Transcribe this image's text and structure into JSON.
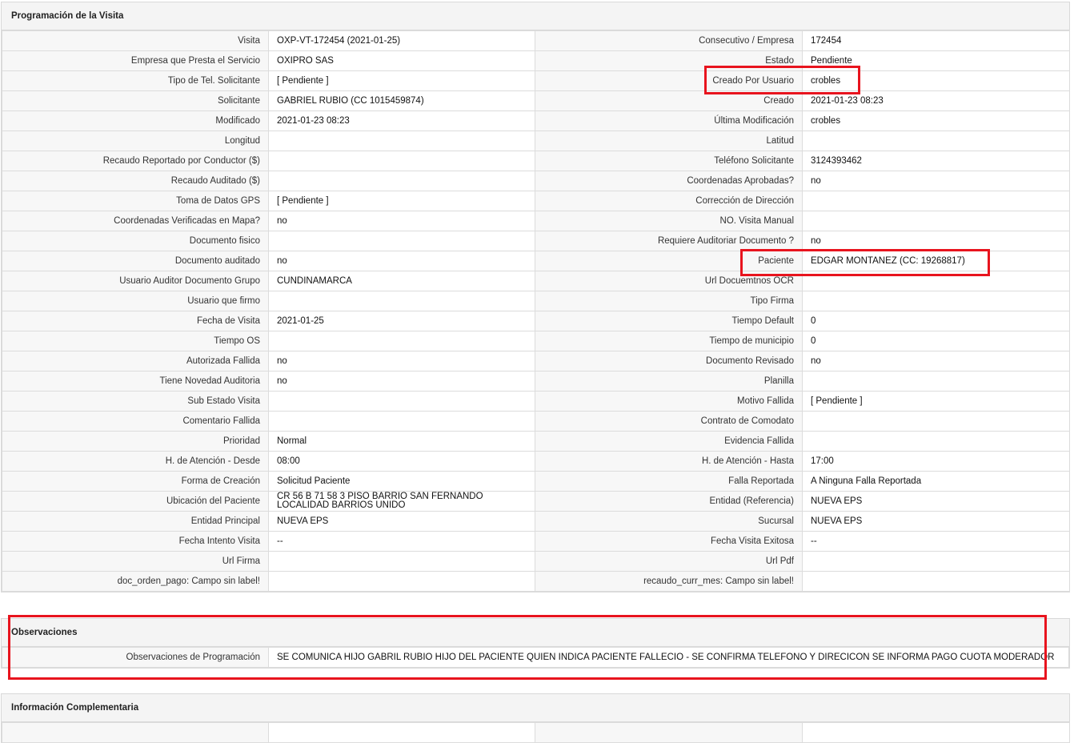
{
  "section1": {
    "title": "Programación de la Visita",
    "rows": [
      [
        "Visita",
        "OXP-VT-172454 (2021-01-25)",
        "Consecutivo / Empresa",
        "172454"
      ],
      [
        "Empresa que Presta el Servicio",
        "OXIPRO SAS",
        "Estado",
        "Pendiente"
      ],
      [
        "Tipo de Tel. Solicitante",
        "[ Pendiente ]",
        "Creado Por Usuario",
        "crobles"
      ],
      [
        "Solicitante",
        "GABRIEL RUBIO (CC 1015459874)",
        "Creado",
        "2021-01-23 08:23"
      ],
      [
        "Modificado",
        "2021-01-23 08:23",
        "Última Modificación",
        " crobles"
      ],
      [
        "Longitud",
        "",
        "Latitud",
        ""
      ],
      [
        "Recaudo Reportado por Conductor ($)",
        "",
        "Teléfono Solicitante",
        "3124393462"
      ],
      [
        "Recaudo Auditado ($)",
        "",
        "Coordenadas Aprobadas?",
        " no"
      ],
      [
        "Toma de Datos GPS",
        "[ Pendiente ]",
        "Corrección de Dirección",
        ""
      ],
      [
        "Coordenadas Verificadas en Mapa?",
        " no",
        "NO. Visita Manual",
        ""
      ],
      [
        "Documento fisico",
        "",
        "Requiere Auditoriar Documento ?",
        " no"
      ],
      [
        "Documento auditado",
        " no",
        "Paciente",
        "EDGAR MONTANEZ (CC: 19268817)"
      ],
      [
        "Usuario Auditor Documento Grupo",
        "CUNDINAMARCA",
        "Url Docuemtnos OCR",
        ""
      ],
      [
        "Usuario que firmo",
        "",
        "Tipo Firma",
        ""
      ],
      [
        "Fecha de Visita",
        " 2021-01-25",
        "Tiempo Default",
        "0"
      ],
      [
        "Tiempo OS",
        "",
        "Tiempo de municipio",
        "0"
      ],
      [
        "Autorizada Fallida",
        " no",
        "Documento Revisado",
        " no"
      ],
      [
        "Tiene Novedad Auditoria",
        " no",
        "Planilla",
        ""
      ],
      [
        "Sub Estado Visita",
        "",
        "Motivo Fallida",
        "[ Pendiente ]"
      ],
      [
        "Comentario Fallida",
        "",
        "Contrato de Comodato",
        ""
      ],
      [
        "Prioridad",
        "Normal",
        "Evidencia Fallida",
        ""
      ],
      [
        "H. de Atención - Desde",
        "08:00",
        "H. de Atención - Hasta",
        "17:00"
      ],
      [
        "Forma de Creación",
        "Solicitud Paciente",
        "Falla Reportada",
        "A Ninguna Falla Reportada"
      ],
      [
        "Ubicación del Paciente",
        "CR 56 B 71 58 3 PISO BARRIO SAN FERNANDO LOCALIDAD BARRIOS UNIDO",
        "Entidad (Referencia)",
        "NUEVA EPS"
      ],
      [
        "Entidad Principal",
        "NUEVA EPS",
        "Sucursal",
        "NUEVA EPS"
      ],
      [
        "Fecha Intento Visita",
        " --",
        "Fecha Visita Exitosa",
        " --"
      ],
      [
        "Url Firma",
        "",
        "Url Pdf",
        ""
      ],
      [
        "doc_orden_pago: Campo sin label!",
        "",
        "recaudo_curr_mes: Campo sin label!",
        ""
      ]
    ]
  },
  "section2": {
    "title": "Observaciones",
    "label": "Observaciones de Programación",
    "value": "SE COMUNICA HIJO GABRIL RUBIO HIJO DEL PACIENTE QUIEN INDICA PACIENTE FALLECIO - SE CONFIRMA TELEFONO Y DIRECICON SE INFORMA PAGO CUOTA MODERADOR"
  },
  "section3": {
    "title": "Información Complementaria"
  },
  "colors": {
    "highlight": "#e8141e",
    "header_bg": "#f4f4f4",
    "border": "#dcdcdc"
  }
}
